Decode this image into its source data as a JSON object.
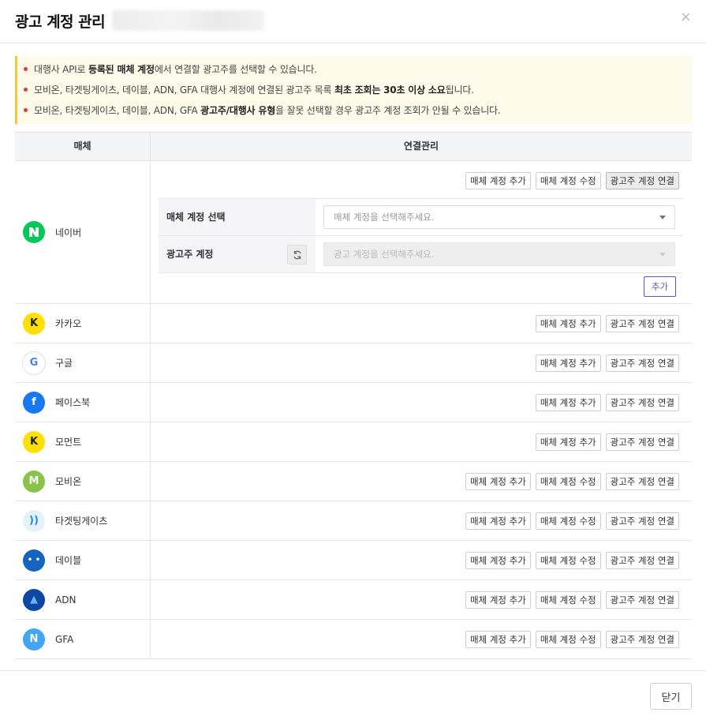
{
  "modal": {
    "title": "광고 계정 관리",
    "close_icon": "×"
  },
  "notice": [
    {
      "parts": [
        {
          "t": "대행사 API로 ",
          "b": false
        },
        {
          "t": "등록된 매체 계정",
          "b": true
        },
        {
          "t": "에서 연결할 광고주를 선택할 수 있습니다.",
          "b": false
        }
      ]
    },
    {
      "parts": [
        {
          "t": "모비온, 타겟팅게이츠, 데이블, ADN, GFA 대행사 계정에 연결된 광고주 목록 ",
          "b": false
        },
        {
          "t": "최초 조회는 30초 이상 소요",
          "b": true
        },
        {
          "t": "됩니다.",
          "b": false
        }
      ]
    },
    {
      "parts": [
        {
          "t": "모비온, 타겟팅게이츠, 데이블, ADN, GFA ",
          "b": false
        },
        {
          "t": "광고주/대행사 유형",
          "b": true
        },
        {
          "t": "을 잘못 선택할 경우 광고주 계정 조회가 안될 수 있습니다.",
          "b": false
        }
      ]
    }
  ],
  "table": {
    "header_media": "매체",
    "header_manage": "연결관리"
  },
  "naver": {
    "name": "네이버",
    "buttons": [
      "매체 계정 추가",
      "매체 계정 수정",
      "광고주 계정 연결"
    ],
    "form": {
      "media_account_label": "매체 계정 선택",
      "media_account_placeholder": "매체 계정을 선택해주세요.",
      "ad_account_label": "광고주 계정",
      "ad_account_placeholder": "광고 계정을 선택해주세요.",
      "add_button": "추가"
    }
  },
  "media": [
    {
      "name": "카카오",
      "logo": "K",
      "logo_bg": "#ffe000",
      "logo_fg": "#222",
      "buttons": [
        "매체 계정 추가",
        "광고주 계정 연결"
      ]
    },
    {
      "name": "구글",
      "logo": "G",
      "logo_bg": "#ffffff",
      "logo_fg": "#4285f4",
      "buttons": [
        "매체 계정 추가",
        "광고주 계정 연결"
      ]
    },
    {
      "name": "페이스북",
      "logo": "f",
      "logo_bg": "#1877f2",
      "logo_fg": "#ffffff",
      "buttons": [
        "매체 계정 추가",
        "광고주 계정 연결"
      ]
    },
    {
      "name": "모먼트",
      "logo": "K",
      "logo_bg": "#ffe000",
      "logo_fg": "#222",
      "buttons": [
        "매체 계정 추가",
        "광고주 계정 연결"
      ]
    },
    {
      "name": "모비온",
      "logo": "M",
      "logo_bg": "#8bc34a",
      "logo_fg": "#ffffff",
      "buttons": [
        "매체 계정 추가",
        "매체 계정 수정",
        "광고주 계정 연결"
      ]
    },
    {
      "name": "타겟팅게이츠",
      "logo": "))",
      "logo_bg": "#e3f2fd",
      "logo_fg": "#1e88e5",
      "buttons": [
        "매체 계정 추가",
        "매체 계정 수정",
        "광고주 계정 연결"
      ]
    },
    {
      "name": "데이블",
      "logo": "• •",
      "logo_bg": "#1565c0",
      "logo_fg": "#ffffff",
      "buttons": [
        "매체 계정 추가",
        "매체 계정 수정",
        "광고주 계정 연결"
      ]
    },
    {
      "name": "ADN",
      "logo": "▲",
      "logo_bg": "#0d47a1",
      "logo_fg": "#64b5f6",
      "buttons": [
        "매체 계정 추가",
        "매체 계정 수정",
        "광고주 계정 연결"
      ]
    },
    {
      "name": "GFA",
      "logo": "N",
      "logo_bg": "#42a5f5",
      "logo_fg": "#ffffff",
      "buttons": [
        "매체 계정 추가",
        "매체 계정 수정",
        "광고주 계정 연결"
      ]
    }
  ],
  "footer": {
    "close_label": "닫기"
  }
}
